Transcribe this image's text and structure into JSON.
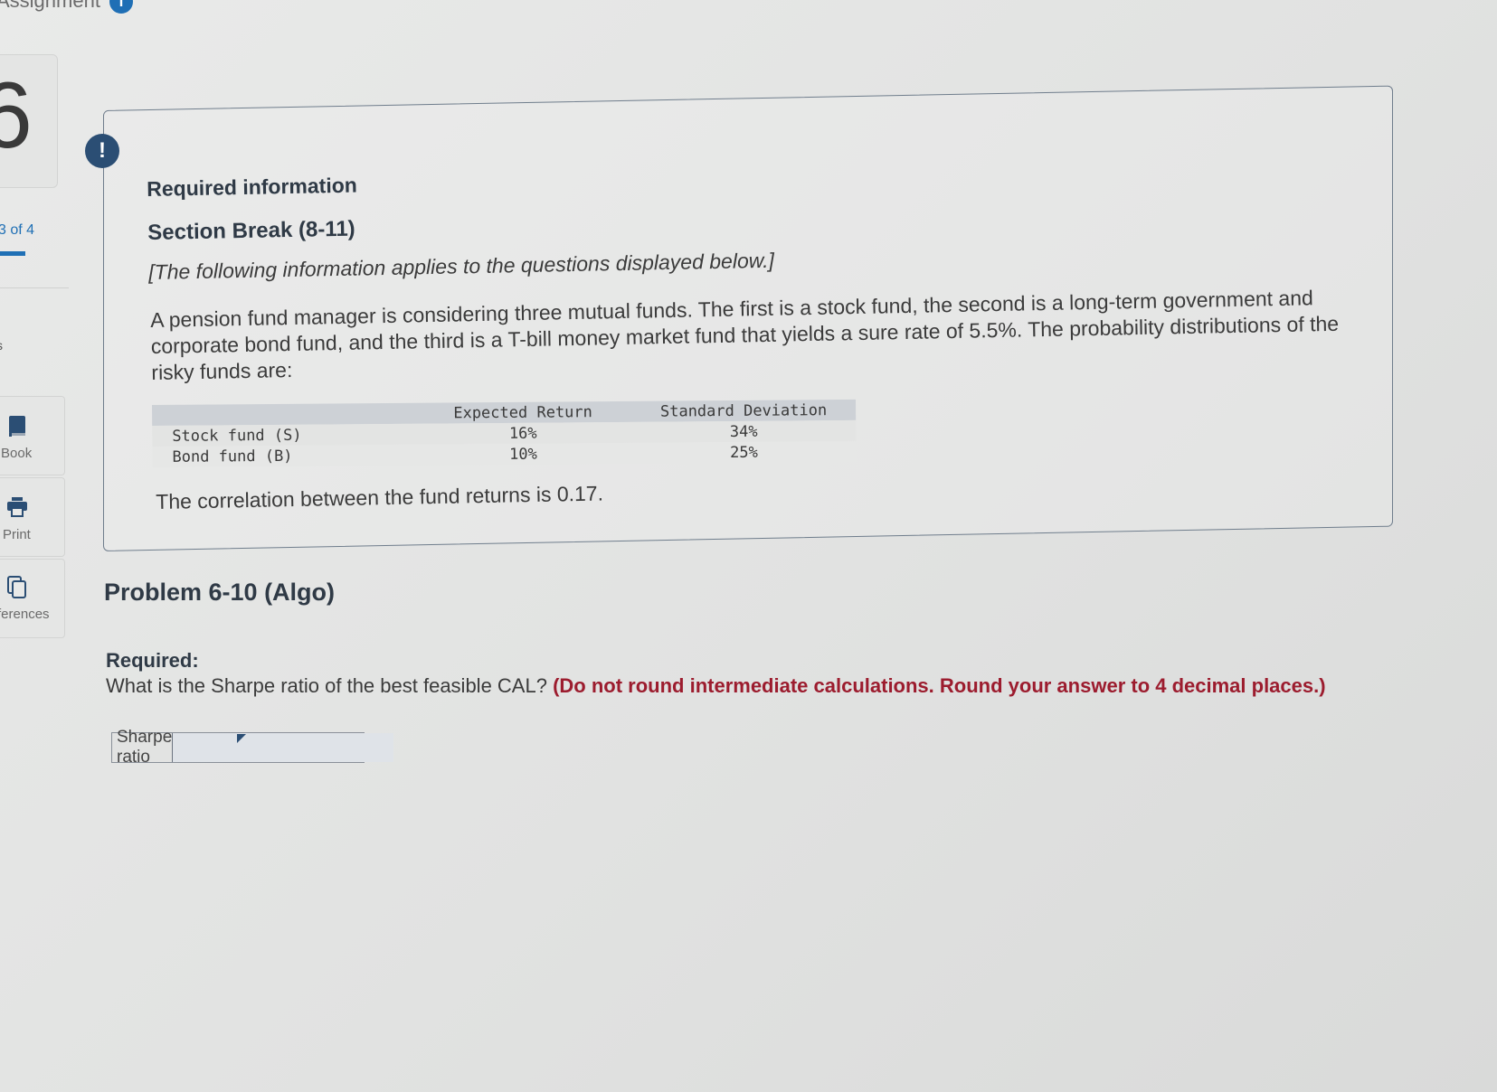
{
  "header": {
    "title": "Assignment",
    "info_icon": "i"
  },
  "sidebar": {
    "question_number": "6",
    "progress_text": "3 of 4",
    "marker": "s",
    "tools": [
      {
        "label": "Book",
        "icon": "book-icon"
      },
      {
        "label": "Print",
        "icon": "printer-icon"
      },
      {
        "label": "ferences",
        "icon": "references-icon"
      }
    ]
  },
  "info_card": {
    "alert_icon": "!",
    "required_info": "Required information",
    "section_break": "Section Break (8-11)",
    "note": "[The following information applies to the questions displayed below.]",
    "paragraph": "A pension fund manager is considering three mutual funds. The first is a stock fund, the second is a long-term government and corporate bond fund, and the third is a T-bill money market fund that yields a sure rate of 5.5%. The probability distributions of the risky funds are:",
    "table": {
      "headers": [
        "",
        "Expected Return",
        "Standard Deviation"
      ],
      "rows": [
        [
          "Stock fund (S)",
          "16%",
          "34%"
        ],
        [
          "Bond fund (B)",
          "10%",
          "25%"
        ]
      ]
    },
    "correlation": "The correlation between the fund returns is 0.17."
  },
  "problem": {
    "title": "Problem 6-10 (Algo)",
    "required_label": "Required:",
    "question": "What is the Sharpe ratio of the best feasible CAL?",
    "instruction": "(Do not round intermediate calculations. Round your answer to 4 decimal places.)",
    "answer_label": "Sharpe ratio",
    "answer_value": "",
    "answer_placeholder": ""
  }
}
